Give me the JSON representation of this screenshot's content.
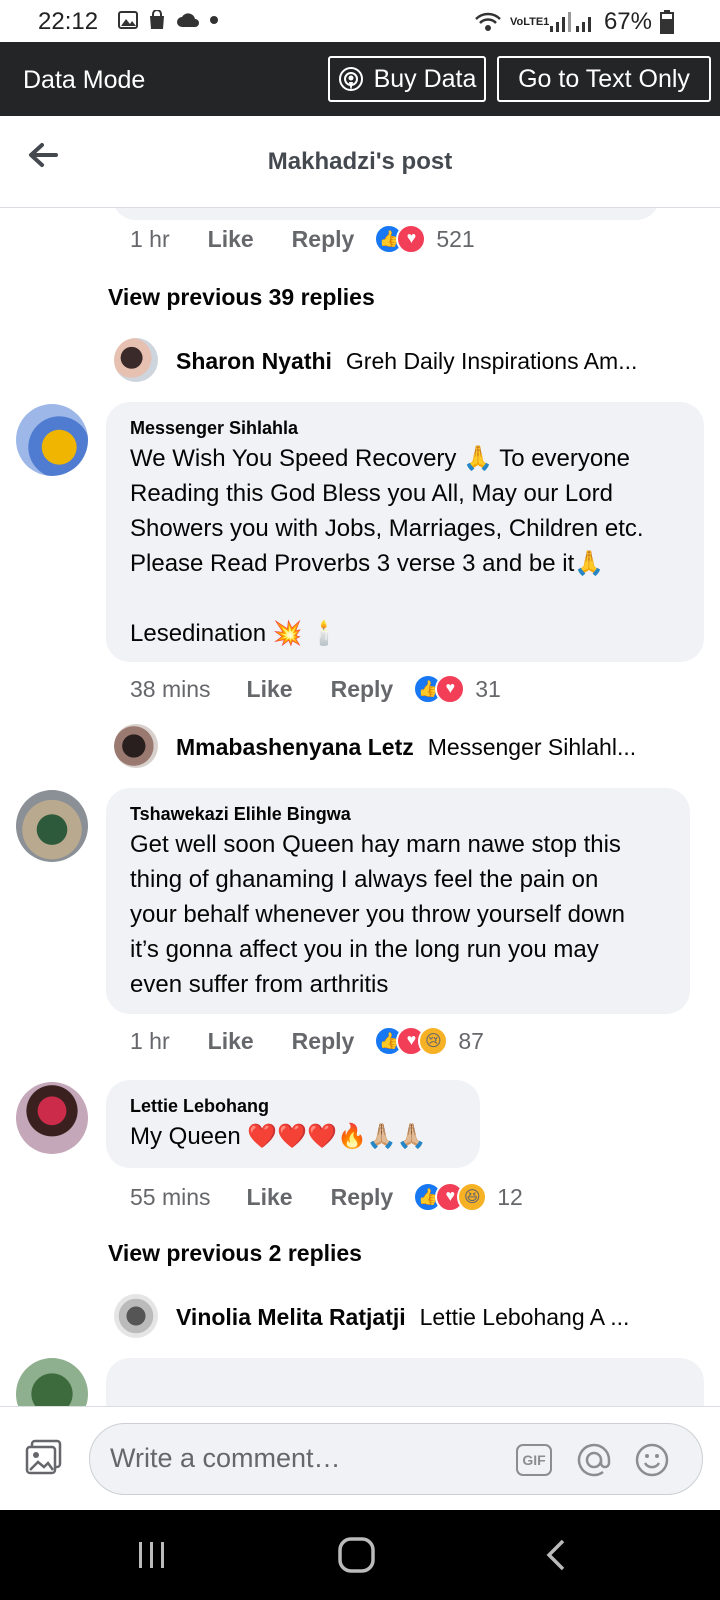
{
  "status_bar": {
    "time": "22:12",
    "network": "VoLTE1",
    "battery": "67%"
  },
  "data_bar": {
    "label": "Data Mode",
    "buy_data": "Buy Data",
    "text_only": "Go to Text Only"
  },
  "header": {
    "title": "Makhadzi's post"
  },
  "top_comment_meta": {
    "time": "1 hr",
    "like": "Like",
    "reply": "Reply",
    "count": "521"
  },
  "thread1": {
    "view_previous": "View previous 39 replies",
    "sub_reply": {
      "name": "Sharon Nyathi",
      "preview": "Greh Daily Inspirations Am..."
    }
  },
  "comments": [
    {
      "author": "Messenger Sihlahla",
      "lines": [
        "We Wish You Speed Recovery 🙏 To everyone",
        "Reading this God Bless you All, May our Lord",
        "Showers you with Jobs, Marriages, Children etc.",
        "Please Read Proverbs 3 verse 3 and be it🙏",
        "",
        "Lesedination 💥 🕯️"
      ],
      "time": "38 mins",
      "like": "Like",
      "reply": "Reply",
      "count": "31"
    },
    {
      "author": "Tshawekazi Elihle Bingwa",
      "lines": [
        "Get well soon Queen hay marn nawe stop this",
        "thing of ghanaming I always feel the pain on",
        "your behalf whenever you throw yourself down",
        "it’s gonna affect you in the long run you may",
        "even suffer from arthritis"
      ],
      "time": "1 hr",
      "like": "Like",
      "reply": "Reply",
      "count": "87"
    },
    {
      "author": "Lettie Lebohang",
      "lines": [
        "My Queen ❤️❤️❤️🔥🙏🏼🙏🏼"
      ],
      "time": "55 mins",
      "like": "Like",
      "reply": "Reply",
      "count": "12"
    }
  ],
  "thread2": {
    "sub_reply": {
      "name": "Mmabashenyana Letz",
      "preview": "Messenger Sihlahl..."
    }
  },
  "thread3": {
    "view_previous": "View previous 2 replies",
    "sub_reply": {
      "name": "Vinolia Melita Ratjatji",
      "preview": "Lettie Lebohang A ..."
    }
  },
  "composer": {
    "placeholder": "Write a comment…",
    "gif": "GIF"
  },
  "colors": {
    "accent": "#1877f2",
    "love": "#f33e58",
    "bubble": "#f0f2f5",
    "data_bar": "#242526"
  }
}
